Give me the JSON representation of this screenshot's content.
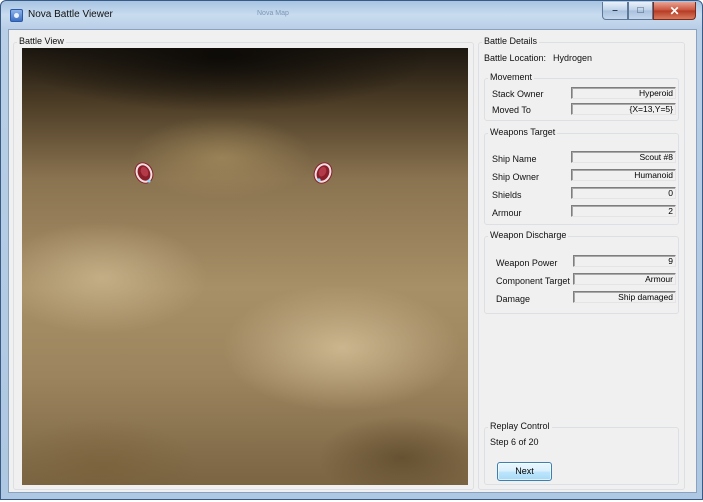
{
  "window": {
    "title": "Nova Battle Viewer",
    "ghost_title": "Nova Map",
    "controls": {
      "minimize": "–",
      "maximize": "□",
      "close": "✕"
    }
  },
  "battle_view": {
    "label": "Battle View"
  },
  "battle_details": {
    "label": "Battle Details",
    "location_label": "Battle Location:",
    "location_value": "Hydrogen"
  },
  "movement": {
    "label": "Movement",
    "stack_owner_label": "Stack Owner",
    "stack_owner_value": "Hyperoid",
    "moved_to_label": "Moved To",
    "moved_to_value": "{X=13,Y=5}"
  },
  "weapons_target": {
    "label": "Weapons Target",
    "ship_name_label": "Ship Name",
    "ship_name_value": "Scout #8",
    "ship_owner_label": "Ship Owner",
    "ship_owner_value": "Humanoid",
    "shields_label": "Shields",
    "shields_value": "0",
    "armour_label": "Armour",
    "armour_value": "2"
  },
  "weapon_discharge": {
    "label": "Weapon Discharge",
    "power_label": "Weapon Power",
    "power_value": "9",
    "component_label": "Component Target",
    "component_value": "Armour",
    "damage_label": "Damage",
    "damage_value": "Ship damaged"
  },
  "replay_control": {
    "label": "Replay Control",
    "step_text": "Step 6 of 20",
    "next_label": "Next"
  },
  "icons": [
    "app-icon",
    "ship-icon"
  ]
}
